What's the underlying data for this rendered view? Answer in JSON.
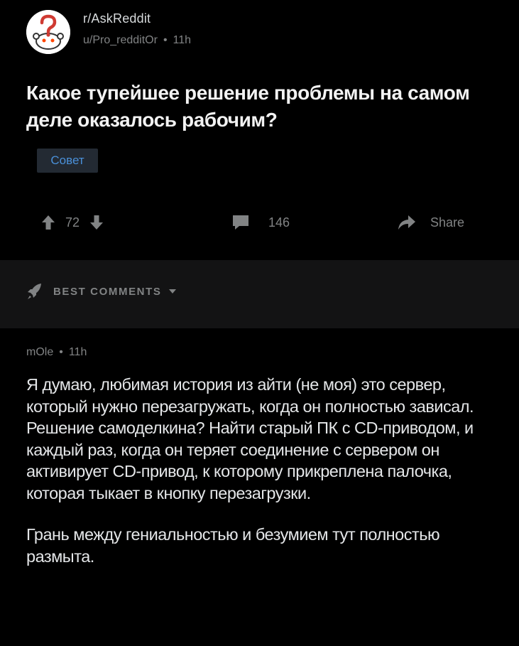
{
  "post": {
    "subreddit": "r/AskReddit",
    "author": "u/Pro_redditOr",
    "age": "11h",
    "title": "Какое тупейшее решение проблемы на самом деле оказалось рабочим?",
    "flair": "Совет",
    "flair_color": "#4a90d9",
    "score": "72",
    "comment_count": "146",
    "share_label": "Share"
  },
  "sort": {
    "label": "BEST COMMENTS",
    "icon": "rocket-icon"
  },
  "comment": {
    "author": "mOle",
    "age": "11h",
    "paragraphs": [
      "Я думаю, любимая история из айти (не моя) это сервер, который нужно перезагружать, когда он полностью зависал. Решение самоделкина? Найти старый ПК с CD-приводом, и каждый раз, когда он теряет соединение с сервером он активирует CD-привод, к которому прикреплена палочка, которая тыкает в кнопку перезагрузки.",
      "Грань между гениальностью и безумием тут полностью размыта."
    ]
  },
  "colors": {
    "background": "#000000",
    "sort_bar": "#131314",
    "muted": "#818384",
    "text": "#e4e6e8"
  }
}
